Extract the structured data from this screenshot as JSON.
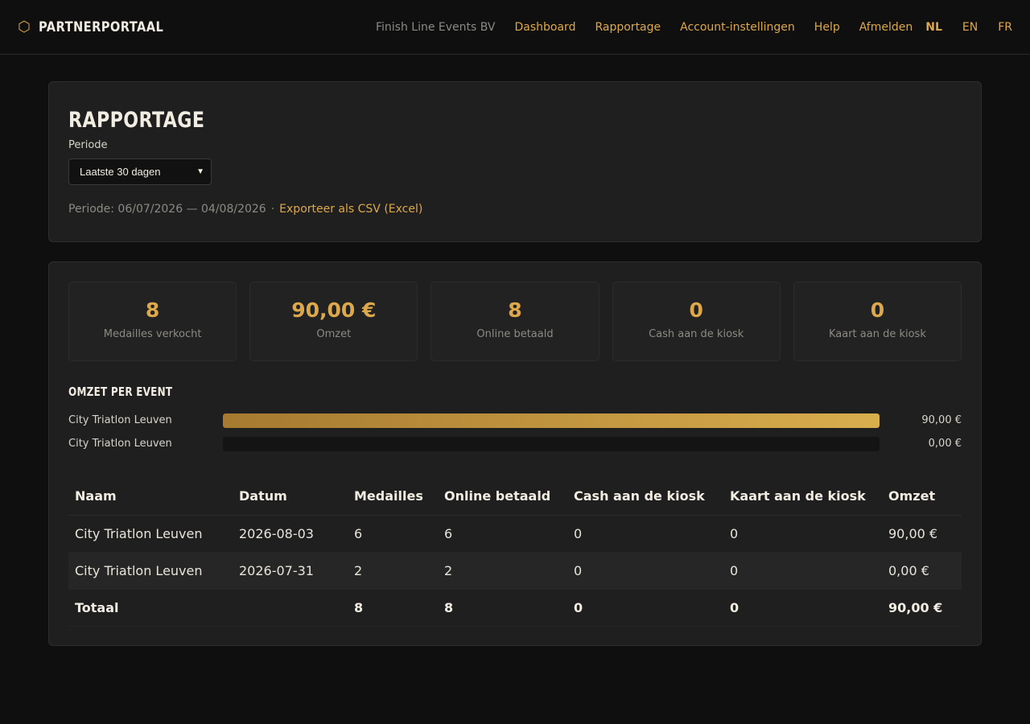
{
  "header": {
    "brand_icon": "hexagon-icon",
    "brand": "PARTNERPORTAAL",
    "org": "Finish Line Events BV",
    "nav": [
      {
        "label": "Dashboard"
      },
      {
        "label": "Rapportage"
      },
      {
        "label": "Account-instellingen"
      },
      {
        "label": "Help"
      },
      {
        "label": "Afmelden"
      }
    ],
    "languages": [
      {
        "label": "NL",
        "active": true
      },
      {
        "label": "EN",
        "active": false
      },
      {
        "label": "FR",
        "active": false
      }
    ]
  },
  "report": {
    "title": "RAPPORTAGE",
    "period_label": "Periode",
    "period_select": "Laatste 30 dagen",
    "period_range": "Periode: 06/07/2026 — 04/08/2026",
    "separator": "·",
    "export_label": "Exporteer als CSV (Excel)"
  },
  "stats": [
    {
      "value": "8",
      "label": "Medailles verkocht"
    },
    {
      "value": "90,00 €",
      "label": "Omzet"
    },
    {
      "value": "8",
      "label": "Online betaald"
    },
    {
      "value": "0",
      "label": "Cash aan de kiosk"
    },
    {
      "value": "0",
      "label": "Kaart aan de kiosk"
    }
  ],
  "revenue_per_event": {
    "title": "OMZET PER EVENT",
    "rows": [
      {
        "name": "City Triatlon Leuven",
        "value": "90,00 €",
        "fraction": 1.0
      },
      {
        "name": "City Triatlon Leuven",
        "value": "0,00 €",
        "fraction": 0.0
      }
    ]
  },
  "table": {
    "headers": [
      "Naam",
      "Datum",
      "Medailles",
      "Online betaald",
      "Cash aan de kiosk",
      "Kaart aan de kiosk",
      "Omzet"
    ],
    "rows": [
      [
        "City Triatlon Leuven",
        "2026-08-03",
        "6",
        "6",
        "0",
        "0",
        "90,00 €"
      ],
      [
        "City Triatlon Leuven",
        "2026-07-31",
        "2",
        "2",
        "0",
        "0",
        "0,00 €"
      ]
    ],
    "total": [
      "Totaal",
      "",
      "8",
      "8",
      "0",
      "0",
      "90,00 €"
    ]
  },
  "colors": {
    "accent": "#dda84a",
    "background": "#0f0f0f",
    "card": "#1f1f1f"
  }
}
